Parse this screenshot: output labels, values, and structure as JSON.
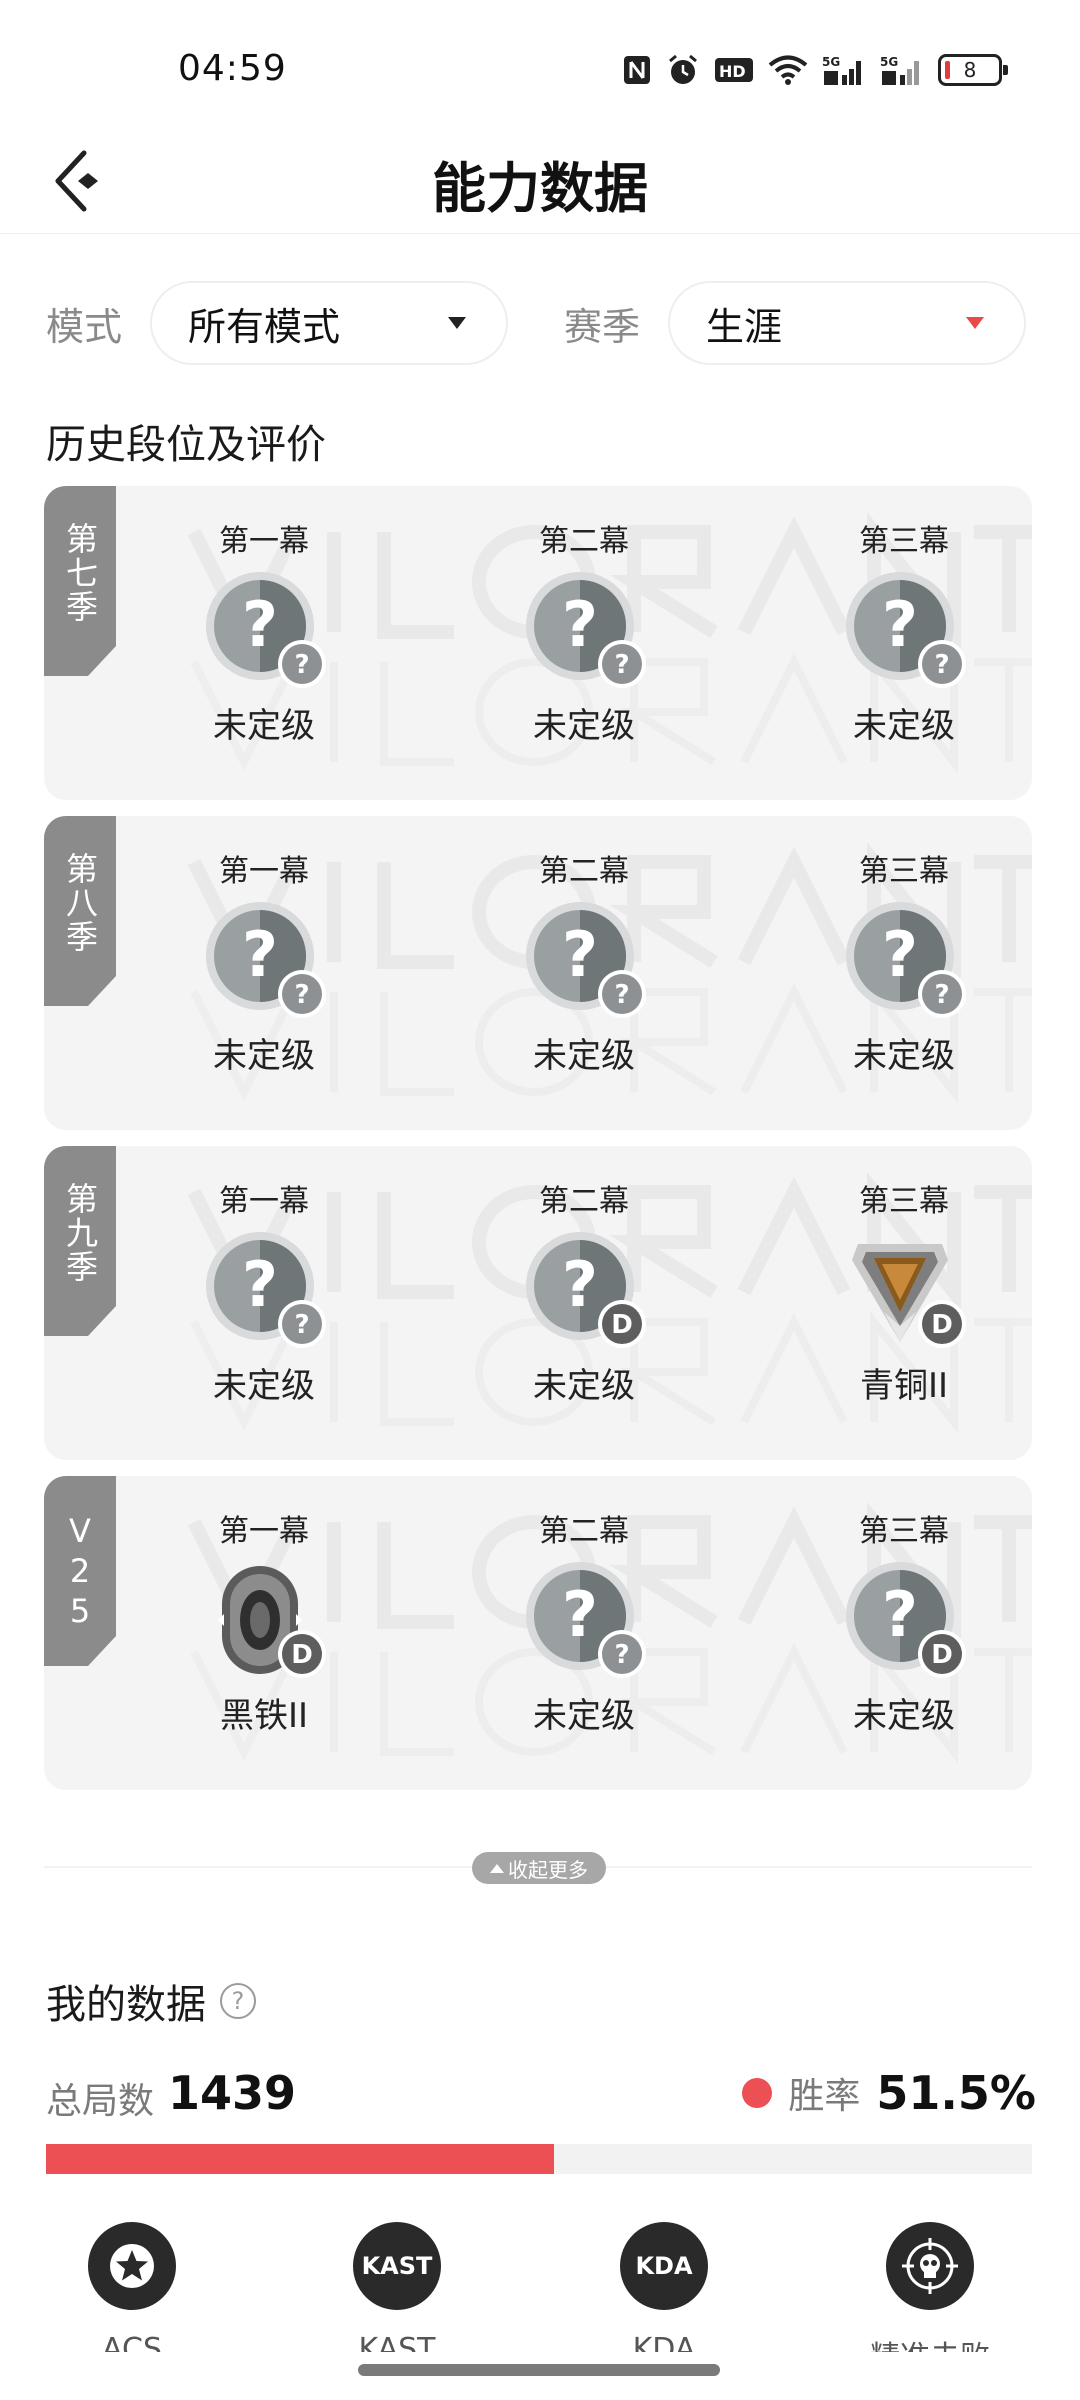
{
  "status_bar": {
    "time": "04:59",
    "icons": [
      "nfc-icon",
      "alarm-icon",
      "hd-icon",
      "wifi-icon",
      "signal-5g-icon",
      "signal-5g-icon",
      "battery-icon"
    ],
    "signal_label": "5G",
    "battery_level": "8"
  },
  "header": {
    "title": "能力数据"
  },
  "filters": {
    "mode_label": "模式",
    "mode_value": "所有模式",
    "season_label": "赛季",
    "season_value": "生涯"
  },
  "history": {
    "title": "历史段位及评价",
    "seasons": [
      {
        "name": "第七季",
        "acts": [
          {
            "label": "第一幕",
            "rank": "未定级",
            "icon": "unranked",
            "badge": "?"
          },
          {
            "label": "第二幕",
            "rank": "未定级",
            "icon": "unranked",
            "badge": "?"
          },
          {
            "label": "第三幕",
            "rank": "未定级",
            "icon": "unranked",
            "badge": "?"
          }
        ]
      },
      {
        "name": "第八季",
        "acts": [
          {
            "label": "第一幕",
            "rank": "未定级",
            "icon": "unranked",
            "badge": "?"
          },
          {
            "label": "第二幕",
            "rank": "未定级",
            "icon": "unranked",
            "badge": "?"
          },
          {
            "label": "第三幕",
            "rank": "未定级",
            "icon": "unranked",
            "badge": "?"
          }
        ]
      },
      {
        "name": "第九季",
        "acts": [
          {
            "label": "第一幕",
            "rank": "未定级",
            "icon": "unranked",
            "badge": "?"
          },
          {
            "label": "第二幕",
            "rank": "未定级",
            "icon": "unranked",
            "badge": "D"
          },
          {
            "label": "第三幕",
            "rank": "青铜II",
            "icon": "bronze",
            "badge": "D"
          }
        ]
      },
      {
        "name": "V25",
        "acts": [
          {
            "label": "第一幕",
            "rank": "黑铁II",
            "icon": "iron",
            "badge": "D"
          },
          {
            "label": "第二幕",
            "rank": "未定级",
            "icon": "unranked",
            "badge": "?"
          },
          {
            "label": "第三幕",
            "rank": "未定级",
            "icon": "unranked",
            "badge": "D"
          }
        ]
      }
    ],
    "collapse_label": "收起更多"
  },
  "my_data": {
    "title": "我的数据",
    "total_label": "总局数",
    "total_value": "1439",
    "winrate_label": "胜率",
    "winrate_value": "51.5%",
    "winrate_fraction": 0.515,
    "accent_color": "#ec5054"
  },
  "stats": [
    {
      "icon": "acs-star-icon",
      "text": "",
      "label": "ACS"
    },
    {
      "icon": "kast-icon",
      "text": "KAST",
      "label": "KAST"
    },
    {
      "icon": "kda-icon",
      "text": "KDA",
      "label": "KDA"
    },
    {
      "icon": "crosshair-skull-icon",
      "text": "",
      "label": "精准击败"
    }
  ]
}
